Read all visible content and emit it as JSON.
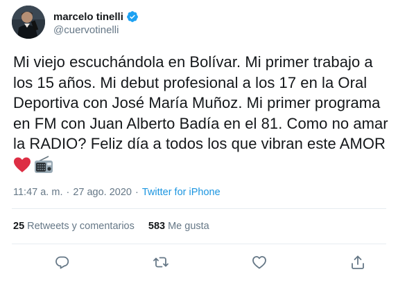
{
  "tweet": {
    "author": {
      "display_name": "marcelo tinelli",
      "handle": "@cuervotinelli",
      "verified": true,
      "avatar_icon": "profile-photo"
    },
    "text_lines": [
      "Mi viejo escuchándola en Bolívar. Mi primer trabajo a",
      "los 15 años. Mi debut profesional a los 17 en la Oral",
      "Deportiva con José María Muñoz. Mi primer programa",
      "en FM con Juan Alberto Badía en el 81. Como no amar",
      "la RADIO? Feliz día a todos los que vibran este AMOR"
    ],
    "emojis": [
      "red-heart-icon",
      "radio-icon"
    ],
    "time": "11:47 a. m.",
    "separator": "·",
    "date": "27 ago. 2020",
    "source": "Twitter for iPhone",
    "stats": {
      "retweets_count": "25",
      "retweets_label": "Retweets y comentarios",
      "likes_count": "583",
      "likes_label": "Me gusta"
    },
    "actions": [
      "reply-icon",
      "retweet-icon",
      "like-icon",
      "share-icon"
    ]
  },
  "colors": {
    "text": "#14171a",
    "secondary": "#657786",
    "link": "#1b95e0",
    "verified": "#1da1f2",
    "divider": "#e6ecf0"
  }
}
